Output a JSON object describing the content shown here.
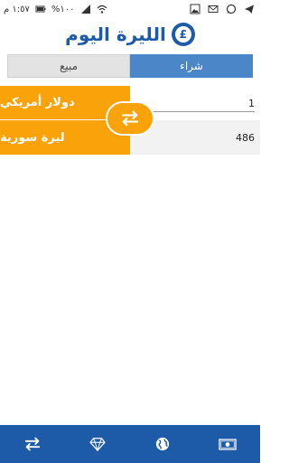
{
  "status_bar": {
    "time": "١:٥٧ م",
    "battery": "%١٠٠"
  },
  "header": {
    "app_title": "الليرة اليوم",
    "logo_symbol": "£"
  },
  "tabs": {
    "sell_label": "مبيع",
    "buy_label": "شراء",
    "active": "buy"
  },
  "converter": {
    "from_currency": "دولار أمريكي",
    "from_value": "1",
    "to_currency": "ليرة سورية",
    "to_value": "486"
  },
  "bottom_nav": {
    "items": [
      "swap-icon",
      "diamond-icon",
      "globe-icon",
      "money-icon"
    ]
  },
  "colors": {
    "primary": "#1d5aa8",
    "accent": "#f9a20a",
    "tab_active": "#4a86c8"
  }
}
